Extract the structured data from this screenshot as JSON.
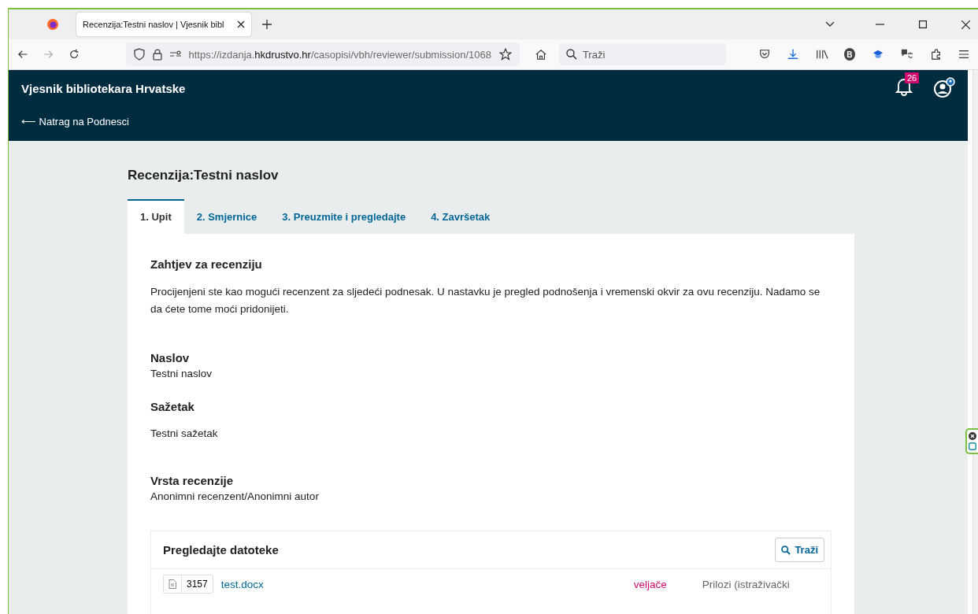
{
  "browser": {
    "tab_title": "Recenzija:Testni naslov | Vjesnik bibl",
    "url": {
      "prefix": "https://izdanja.",
      "domain": "hkdrustvo.hr",
      "path": "/casopisi/vbh/reviewer/submission/1068"
    },
    "search_placeholder": "Traži",
    "extension_letter": "B"
  },
  "header": {
    "site_title": "Vjesnik bibliotekara Hrvatske",
    "back_link": "⟵ Natrag na Podnesci",
    "notification_count": "26"
  },
  "page_title": "Recenzija:Testni naslov",
  "tabs": [
    {
      "label": "1. Upit",
      "selected": true
    },
    {
      "label": "2. Smjernice",
      "selected": false
    },
    {
      "label": "3. Preuzmite i pregledajte",
      "selected": false
    },
    {
      "label": "4. Završetak",
      "selected": false
    }
  ],
  "request": {
    "heading": "Zahtjev za recenziju",
    "text": "Procijenjeni ste kao mogući recenzent za sljedeći podnesak. U nastavku je pregled podnošenja i vremenski okvir za ovu recenziju. Nadamo se da ćete tome moći pridonijeti."
  },
  "fields": [
    {
      "label": "Naslov",
      "value": "Testni naslov"
    },
    {
      "label": "Sažetak",
      "value": "Testni sažetak"
    },
    {
      "label": "Vrsta recenzije",
      "value": "Anonimni recenzent/Anonimni autor"
    }
  ],
  "files": {
    "title": "Pregledajte datoteke",
    "search_button": "Traži",
    "rows": [
      {
        "id": "3157",
        "name": "test.docx",
        "date": "veljače",
        "component": "Prilozi (istraživački"
      }
    ]
  }
}
